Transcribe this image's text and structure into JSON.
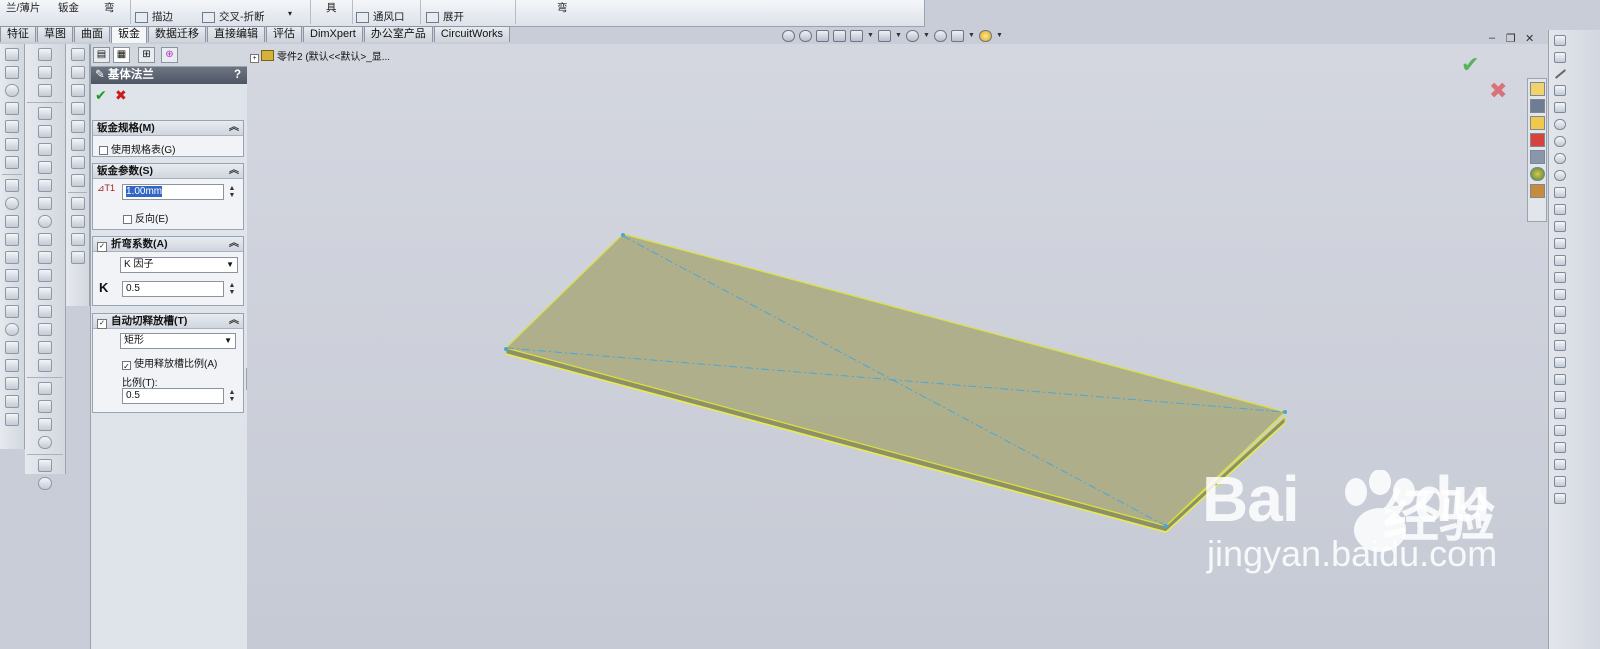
{
  "ribbon": {
    "items": [
      "兰/薄片",
      "钣金",
      "弯",
      "描边",
      "交叉-折断",
      "具",
      "通风口",
      "展开",
      "弯"
    ]
  },
  "tabs": [
    {
      "label": "特征"
    },
    {
      "label": "草图"
    },
    {
      "label": "曲面"
    },
    {
      "label": "钣金",
      "active": true
    },
    {
      "label": "数据迁移"
    },
    {
      "label": "直接编辑"
    },
    {
      "label": "评估"
    },
    {
      "label": "DimXpert"
    },
    {
      "label": "办公室产品"
    },
    {
      "label": "CircuitWorks"
    }
  ],
  "property_manager": {
    "title": "基体法兰",
    "help": "?",
    "groups": {
      "gauge": {
        "header": "钣金规格(M)",
        "use_gauge_table": "使用规格表(G)"
      },
      "params": {
        "header": "钣金参数(S)",
        "thickness": "1.00mm",
        "reverse": "反向(E)"
      },
      "bend": {
        "header": "折弯系数(A)",
        "type": "K 因子",
        "k_label": "K",
        "k_value": "0.5"
      },
      "relief": {
        "header": "自动切释放槽(T)",
        "type": "矩形",
        "use_ratio": "使用释放槽比例(A)",
        "ratio_label": "比例(T):",
        "ratio_value": "0.5"
      }
    }
  },
  "tree": {
    "part_label": "零件2  (默认<<默认>_显..."
  },
  "colors": {
    "plate_fill": "#a9a97c",
    "plate_edge": "#d8e23a",
    "centerline": "#4aa6d8",
    "ok_green": "#1c9a28",
    "cancel_red": "#d01818"
  },
  "watermark": {
    "brand": "Bai",
    "brand2": "du",
    "chinese": "经验",
    "url": "jingyan.baidu.com"
  }
}
